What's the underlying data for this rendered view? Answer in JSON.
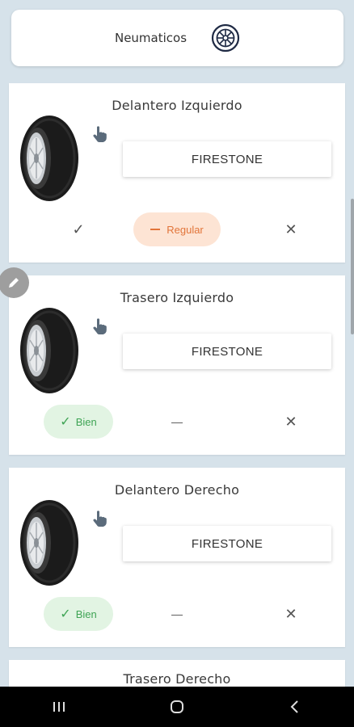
{
  "header": {
    "title": "Neumaticos",
    "icon": "wheel-icon"
  },
  "tires": [
    {
      "title": "Delantero Izquierdo",
      "brand": "FIRESTONE",
      "left": "✓",
      "middle": "Regular",
      "right": "✕",
      "selected": "regular"
    },
    {
      "title": "Trasero Izquierdo",
      "brand": "FIRESTONE",
      "left": "Bien",
      "middle": "—",
      "right": "✕",
      "selected": "bien"
    },
    {
      "title": "Delantero Derecho",
      "brand": "FIRESTONE",
      "left": "Bien",
      "middle": "—",
      "right": "✕",
      "selected": "bien"
    },
    {
      "title": "Trasero Derecho"
    }
  ],
  "colors": {
    "background": "#d6e2ea",
    "regular_bg": "#fde4d4",
    "regular_fg": "#e2753a",
    "bien_bg": "#e2f4e3",
    "bien_fg": "#3fa455"
  },
  "nav": {
    "icons": [
      "recent-apps-icon",
      "home-icon",
      "back-icon"
    ]
  }
}
